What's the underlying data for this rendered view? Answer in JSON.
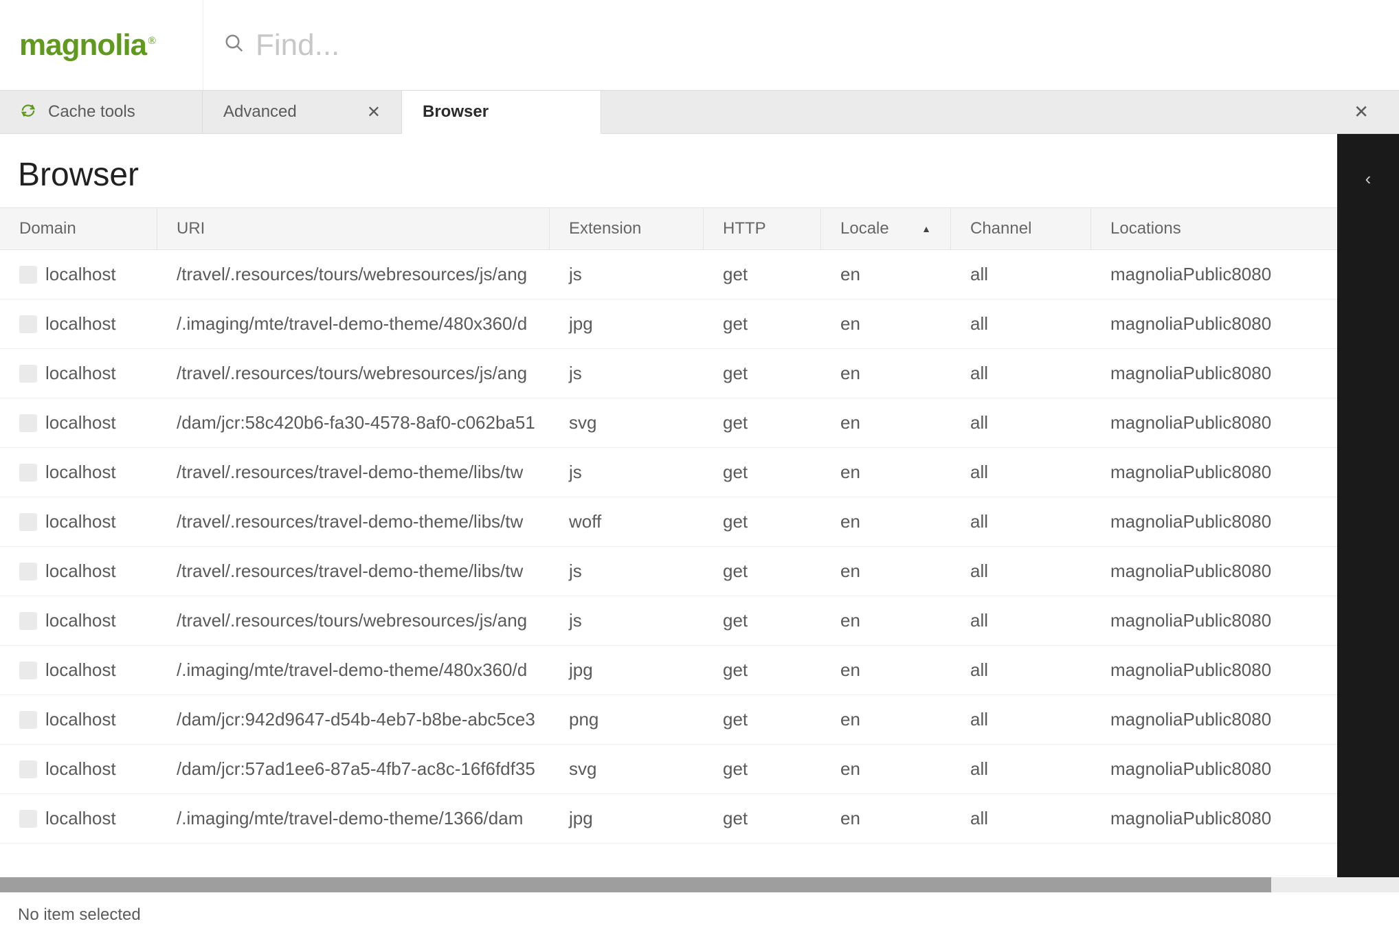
{
  "logo": {
    "text": "magnolia",
    "reg": "®"
  },
  "search": {
    "placeholder": "Find..."
  },
  "tabs": {
    "home": {
      "label": "Cache tools"
    },
    "items": [
      {
        "label": "Advanced",
        "closable": true,
        "active": false
      },
      {
        "label": "Browser",
        "closable": false,
        "active": true
      }
    ]
  },
  "page": {
    "title": "Browser"
  },
  "table": {
    "sorted_col": "locale",
    "columns": [
      {
        "key": "domain",
        "label": "Domain"
      },
      {
        "key": "uri",
        "label": "URI"
      },
      {
        "key": "extension",
        "label": "Extension"
      },
      {
        "key": "http",
        "label": "HTTP"
      },
      {
        "key": "locale",
        "label": "Locale"
      },
      {
        "key": "channel",
        "label": "Channel"
      },
      {
        "key": "locations",
        "label": "Locations"
      }
    ],
    "rows": [
      {
        "domain": "localhost",
        "uri": "/travel/.resources/tours/webresources/js/ang",
        "extension": "js",
        "http": "get",
        "locale": "en",
        "channel": "all",
        "locations": "magnoliaPublic8080"
      },
      {
        "domain": "localhost",
        "uri": "/.imaging/mte/travel-demo-theme/480x360/d",
        "extension": "jpg",
        "http": "get",
        "locale": "en",
        "channel": "all",
        "locations": "magnoliaPublic8080"
      },
      {
        "domain": "localhost",
        "uri": "/travel/.resources/tours/webresources/js/ang",
        "extension": "js",
        "http": "get",
        "locale": "en",
        "channel": "all",
        "locations": "magnoliaPublic8080"
      },
      {
        "domain": "localhost",
        "uri": "/dam/jcr:58c420b6-fa30-4578-8af0-c062ba51",
        "extension": "svg",
        "http": "get",
        "locale": "en",
        "channel": "all",
        "locations": "magnoliaPublic8080"
      },
      {
        "domain": "localhost",
        "uri": "/travel/.resources/travel-demo-theme/libs/tw",
        "extension": "js",
        "http": "get",
        "locale": "en",
        "channel": "all",
        "locations": "magnoliaPublic8080"
      },
      {
        "domain": "localhost",
        "uri": "/travel/.resources/travel-demo-theme/libs/tw",
        "extension": "woff",
        "http": "get",
        "locale": "en",
        "channel": "all",
        "locations": "magnoliaPublic8080"
      },
      {
        "domain": "localhost",
        "uri": "/travel/.resources/travel-demo-theme/libs/tw",
        "extension": "js",
        "http": "get",
        "locale": "en",
        "channel": "all",
        "locations": "magnoliaPublic8080"
      },
      {
        "domain": "localhost",
        "uri": "/travel/.resources/tours/webresources/js/ang",
        "extension": "js",
        "http": "get",
        "locale": "en",
        "channel": "all",
        "locations": "magnoliaPublic8080"
      },
      {
        "domain": "localhost",
        "uri": "/.imaging/mte/travel-demo-theme/480x360/d",
        "extension": "jpg",
        "http": "get",
        "locale": "en",
        "channel": "all",
        "locations": "magnoliaPublic8080"
      },
      {
        "domain": "localhost",
        "uri": "/dam/jcr:942d9647-d54b-4eb7-b8be-abc5ce3",
        "extension": "png",
        "http": "get",
        "locale": "en",
        "channel": "all",
        "locations": "magnoliaPublic8080"
      },
      {
        "domain": "localhost",
        "uri": "/dam/jcr:57ad1ee6-87a5-4fb7-ac8c-16f6fdf35",
        "extension": "svg",
        "http": "get",
        "locale": "en",
        "channel": "all",
        "locations": "magnoliaPublic8080"
      },
      {
        "domain": "localhost",
        "uri": "/.imaging/mte/travel-demo-theme/1366/dam",
        "extension": "jpg",
        "http": "get",
        "locale": "en",
        "channel": "all",
        "locations": "magnoliaPublic8080"
      }
    ]
  },
  "status": {
    "text": "No item selected"
  }
}
